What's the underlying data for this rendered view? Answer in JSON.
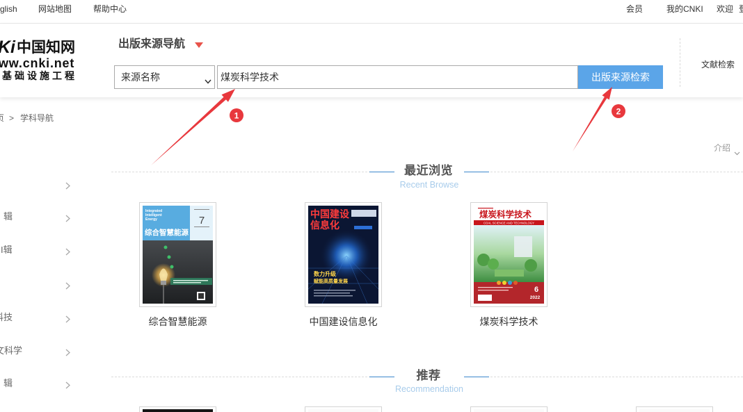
{
  "topbar": {
    "language": "glish",
    "sitemap": "网站地图",
    "help": "帮助中心",
    "member": "会员",
    "my_cnki": "我的CNKI",
    "welcome": "欢迎",
    "login": "登"
  },
  "logo": {
    "mark": "Ki",
    "name_cn": "中国知网",
    "url": "ww.cnki.net",
    "slogan": "基础设施工程"
  },
  "search": {
    "nav_title": "出版来源导航",
    "field_select": "来源名称",
    "query": "煤炭科学技术",
    "submit": "出版来源检索",
    "doc_search": "文献检索"
  },
  "annotations": [
    {
      "label": "1"
    },
    {
      "label": "2"
    }
  ],
  "breadcrumb": {
    "home": "页",
    "separator": ">",
    "current": "学科导航"
  },
  "sidebar": {
    "items": [
      {
        "label": ""
      },
      {
        "label": "辑"
      },
      {
        "label": "I辑"
      },
      {
        "label": ""
      },
      {
        "label": "科技"
      },
      {
        "label": "文科学"
      },
      {
        "label": "辑"
      }
    ]
  },
  "intro_toggle": "介绍",
  "recent": {
    "title": "最近浏览",
    "subtitle": "Recent Browse",
    "items": [
      {
        "title": "综合智慧能源",
        "cover": {
          "en_line1": "Integrated",
          "en_line2": "Intelligent",
          "en_line3": "Energy",
          "cn_title": "综合智慧能源",
          "issue": "7"
        }
      },
      {
        "title": "中国建设信息化",
        "cover": {
          "title_line1": "中国建设",
          "title_line2": "信息化",
          "headline1": "数力升级",
          "headline2": "赋能高质量发展"
        }
      },
      {
        "title": "煤炭科学技术",
        "cover": {
          "cn_title": "煤炭科学技术",
          "en_title": "COAL SCIENCE AND TECHNOLOGY",
          "issue": "6",
          "year": "2022"
        }
      }
    ]
  },
  "recommend": {
    "title": "推荐",
    "subtitle": "Recommendation"
  },
  "icons": {
    "nav_toggle": "triangle-down-icon",
    "select_arrow": "chevron-down-icon",
    "sidebar_expand": "chevron-right-icon",
    "intro_toggle": "chevron-down-icon"
  },
  "colors": {
    "search_button": "#5ba5e8",
    "annotation": "#e8383d",
    "section_line": "#3b86cc",
    "nav_triangle": "#e8534a"
  }
}
